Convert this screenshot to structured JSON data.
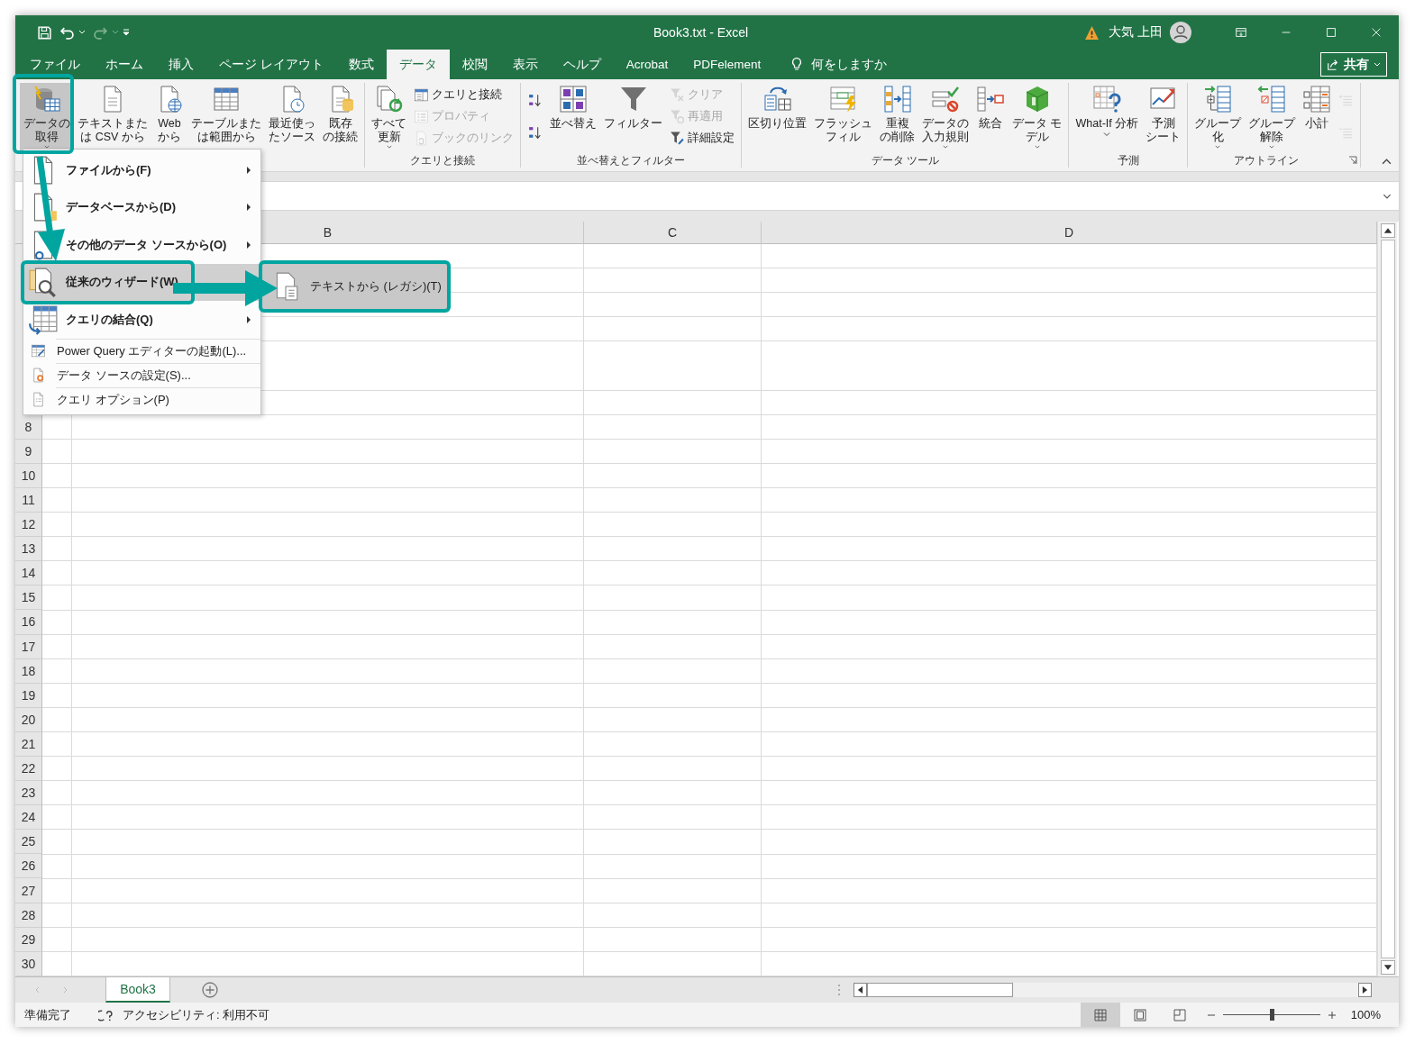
{
  "window": {
    "title": "Book3.txt  -  Excel",
    "user": "大気 上田",
    "share_button": "共有"
  },
  "tabs": [
    {
      "label": "ファイル",
      "selected": false
    },
    {
      "label": "ホーム",
      "selected": false
    },
    {
      "label": "挿入",
      "selected": false
    },
    {
      "label": "ページ レイアウト",
      "selected": false
    },
    {
      "label": "数式",
      "selected": false
    },
    {
      "label": "データ",
      "selected": true
    },
    {
      "label": "校閲",
      "selected": false
    },
    {
      "label": "表示",
      "selected": false
    },
    {
      "label": "ヘルプ",
      "selected": false
    },
    {
      "label": "Acrobat",
      "selected": false
    },
    {
      "label": "PDFelement",
      "selected": false
    }
  ],
  "tell_me": "何をしますか",
  "ribbon_groups": [
    {
      "buttons": [
        {
          "kind": "large",
          "lines": [
            "データの",
            "取得"
          ],
          "dropdown": true,
          "pressed": true,
          "disabled": false
        },
        {
          "kind": "large",
          "lines": [
            "テキストまた",
            "は CSV から"
          ],
          "dropdown": false,
          "pressed": false,
          "disabled": false
        },
        {
          "kind": "large",
          "lines": [
            "Web",
            "から"
          ],
          "dropdown": false,
          "pressed": false,
          "disabled": false
        },
        {
          "kind": "large",
          "lines": [
            "テーブルまた",
            "は範囲から"
          ],
          "dropdown": false,
          "pressed": false,
          "disabled": false
        },
        {
          "kind": "large",
          "lines": [
            "最近使っ",
            "たソース"
          ],
          "dropdown": false,
          "pressed": false,
          "disabled": false
        },
        {
          "kind": "large",
          "lines": [
            "既存",
            "の接続"
          ],
          "dropdown": false,
          "pressed": false,
          "disabled": false
        }
      ]
    },
    {
      "label": "クエリと接続",
      "buttons": [
        {
          "kind": "large",
          "lines": [
            "すべて",
            "更新"
          ],
          "dropdown": true,
          "pressed": false,
          "disabled": false
        },
        {
          "kind": "small",
          "lines": [
            "クエリと接続"
          ],
          "dropdown": false,
          "pressed": false,
          "disabled": false
        },
        {
          "kind": "small",
          "lines": [
            "プロパティ"
          ],
          "dropdown": false,
          "pressed": false,
          "disabled": true
        },
        {
          "kind": "small",
          "lines": [
            "ブックのリンク"
          ],
          "dropdown": false,
          "pressed": false,
          "disabled": true
        }
      ]
    },
    {
      "label": "並べ替えとフィルター",
      "buttons": [
        {
          "kind": "icon",
          "dropdown": false,
          "pressed": false,
          "disabled": false
        },
        {
          "kind": "icon",
          "dropdown": false,
          "pressed": false,
          "disabled": false
        },
        {
          "kind": "large",
          "lines": [
            "並べ替え"
          ],
          "dropdown": false,
          "pressed": false,
          "disabled": false
        },
        {
          "kind": "large",
          "lines": [
            "フィルター"
          ],
          "dropdown": false,
          "pressed": false,
          "disabled": false
        },
        {
          "kind": "small",
          "lines": [
            "クリア"
          ],
          "dropdown": false,
          "pressed": false,
          "disabled": true
        },
        {
          "kind": "small",
          "lines": [
            "再適用"
          ],
          "dropdown": false,
          "pressed": false,
          "disabled": true
        },
        {
          "kind": "small",
          "lines": [
            "詳細設定"
          ],
          "dropdown": false,
          "pressed": false,
          "disabled": false
        }
      ]
    },
    {
      "label": "データ ツール",
      "buttons": [
        {
          "kind": "large",
          "lines": [
            "区切り位置"
          ],
          "dropdown": false,
          "pressed": false,
          "disabled": false
        },
        {
          "kind": "large",
          "lines": [
            "フラッシュ",
            "フィル"
          ],
          "dropdown": false,
          "pressed": false,
          "disabled": false
        },
        {
          "kind": "large",
          "lines": [
            "重複",
            "の削除"
          ],
          "dropdown": false,
          "pressed": false,
          "disabled": false
        },
        {
          "kind": "large",
          "lines": [
            "データの",
            "入力規則"
          ],
          "dropdown": true,
          "pressed": false,
          "disabled": false
        },
        {
          "kind": "large",
          "lines": [
            "統合"
          ],
          "dropdown": false,
          "pressed": false,
          "disabled": false
        },
        {
          "kind": "large",
          "lines": [
            "データ モ",
            "デル"
          ],
          "dropdown": true,
          "pressed": false,
          "disabled": false
        }
      ]
    },
    {
      "label": "予測",
      "buttons": [
        {
          "kind": "large",
          "lines": [
            "What-If 分析"
          ],
          "dropdown": true,
          "pressed": false,
          "disabled": false
        },
        {
          "kind": "large",
          "lines": [
            "予測",
            "シート"
          ],
          "dropdown": false,
          "pressed": false,
          "disabled": false
        }
      ]
    },
    {
      "label": "アウトライン",
      "buttons": [
        {
          "kind": "large",
          "lines": [
            "グループ",
            "化"
          ],
          "dropdown": true,
          "pressed": false,
          "disabled": false
        },
        {
          "kind": "large",
          "lines": [
            "グループ",
            "解除"
          ],
          "dropdown": true,
          "pressed": false,
          "disabled": false
        },
        {
          "kind": "large",
          "lines": [
            "小計"
          ],
          "dropdown": false,
          "pressed": false,
          "disabled": false
        },
        {
          "kind": "icon",
          "dropdown": false,
          "pressed": false,
          "disabled": true
        },
        {
          "kind": "icon",
          "dropdown": false,
          "pressed": false,
          "disabled": true
        }
      ]
    }
  ],
  "menu": {
    "items": [
      {
        "kind": "large",
        "label": "ファイルから(F)",
        "has_submenu": true,
        "selected": false
      },
      {
        "kind": "large",
        "label": "データベースから(D)",
        "has_submenu": true,
        "selected": false
      },
      {
        "kind": "large",
        "label": "その他のデータ ソースから(O)",
        "has_submenu": true,
        "selected": false
      },
      {
        "kind": "large",
        "label": "従来のウィザード(W)",
        "has_submenu": false,
        "selected": true
      },
      {
        "kind": "large",
        "label": "クエリの結合(Q)",
        "has_submenu": true,
        "selected": false
      },
      {
        "kind": "small",
        "label": "Power Query エディターの起動(L)...",
        "has_submenu": false,
        "selected": false
      },
      {
        "kind": "small",
        "label": "データ ソースの設定(S)...",
        "has_submenu": false,
        "selected": false
      },
      {
        "kind": "small",
        "label": "クエリ オプション(P)",
        "has_submenu": false,
        "selected": false
      }
    ],
    "submenu": [
      {
        "label": "テキストから (レガシ)(T)",
        "selected": true
      }
    ]
  },
  "grid": {
    "columns": [
      "B",
      "C",
      "D"
    ],
    "row_numbers": [
      "8",
      "9",
      "10",
      "11",
      "12",
      "13",
      "14",
      "15",
      "16",
      "17",
      "18",
      "19",
      "20",
      "21",
      "22",
      "23",
      "24",
      "25",
      "26",
      "27",
      "28",
      "29",
      "30"
    ]
  },
  "sheet_tabs": [
    {
      "label": "Book3",
      "selected": true
    }
  ],
  "status_bar": {
    "ready": "準備完了",
    "accessibility": "アクセシビリティ: 利用不可",
    "view_buttons": [
      {
        "selected": true
      },
      {
        "selected": false
      },
      {
        "selected": false
      }
    ],
    "zoom": {
      "level": 0.5,
      "label": "100%"
    }
  }
}
